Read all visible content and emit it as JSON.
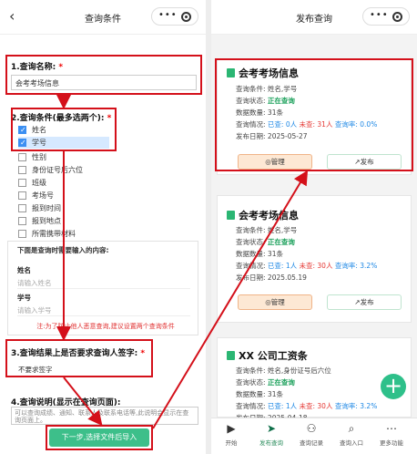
{
  "left": {
    "nav_title": "查询条件",
    "q1": {
      "label": "1.查询名称:",
      "req": "*",
      "value": "会考考场信息"
    },
    "q2": {
      "label": "2.查询条件(最多选两个):",
      "req": "*",
      "options": [
        {
          "label": "姓名",
          "checked": true
        },
        {
          "label": "学号",
          "checked": true
        },
        {
          "label": "性别",
          "checked": false
        },
        {
          "label": "身份证号后六位",
          "checked": false
        },
        {
          "label": "班级",
          "checked": false
        },
        {
          "label": "考场号",
          "checked": false
        },
        {
          "label": "报到时间",
          "checked": false
        },
        {
          "label": "报到地点",
          "checked": false
        },
        {
          "label": "所需携带材料",
          "checked": false
        }
      ]
    },
    "preview": {
      "heading": "下面是查询时需要输入的内容:",
      "f1_label": "姓名",
      "f1_placeholder": "请输入姓名",
      "f2_label": "学号",
      "f2_placeholder": "请输入学号",
      "note": "注:为了防止他人恶意查询,建议设置两个查询条件"
    },
    "q3": {
      "label": "3.查询结果上是否要求查询人签字:",
      "req": "*",
      "value": "不要求签字"
    },
    "q4": {
      "label": "4.查询说明(显示在查询页面):",
      "value": "可以查询成绩、通知、联系人及联系电话等,此说明会显示在查询页面上。"
    },
    "submit": "下一步,选择文件后导入"
  },
  "right": {
    "nav_title": "发布查询",
    "cards": [
      {
        "title": "会考考场信息",
        "cond_label": "查询条件:",
        "cond": "姓名,学号",
        "status_label": "查询状态:",
        "status": "正在查询",
        "count_label": "数据数量:",
        "count": "31条",
        "stat_label": "查询情况:",
        "stat_a": "已查: 0人",
        "stat_b": "未查: 31人",
        "stat_c": "查询率: 0.0%",
        "date_label": "发布日期:",
        "date": "2025-05-27",
        "manage": "管理",
        "publish": "发布"
      },
      {
        "title": "会考考场信息",
        "cond_label": "查询条件:",
        "cond": "姓名,学号",
        "status_label": "查询状态:",
        "status": "正在查询",
        "count_label": "数据数量:",
        "count": "31条",
        "stat_label": "查询情况:",
        "stat_a": "已查: 1人",
        "stat_b": "未查: 30人",
        "stat_c": "查询率: 3.2%",
        "date_label": "发布日期:",
        "date": "2025.05.19",
        "manage": "管理",
        "publish": "发布"
      },
      {
        "title": "XX 公司工资条",
        "cond_label": "查询条件:",
        "cond": "姓名,身份证号后六位",
        "status_label": "查询状态:",
        "status": "正在查询",
        "count_label": "数据数量:",
        "count": "31条",
        "stat_label": "查询情况:",
        "stat_a": "已查: 1人",
        "stat_b": "未查: 30人",
        "stat_c": "查询率: 3.2%",
        "date_label": "发布日期:",
        "date": "2025-04-18"
      }
    ],
    "tabs": [
      "开始",
      "发布查询",
      "查询记录",
      "查询入口",
      "更多功能"
    ]
  }
}
